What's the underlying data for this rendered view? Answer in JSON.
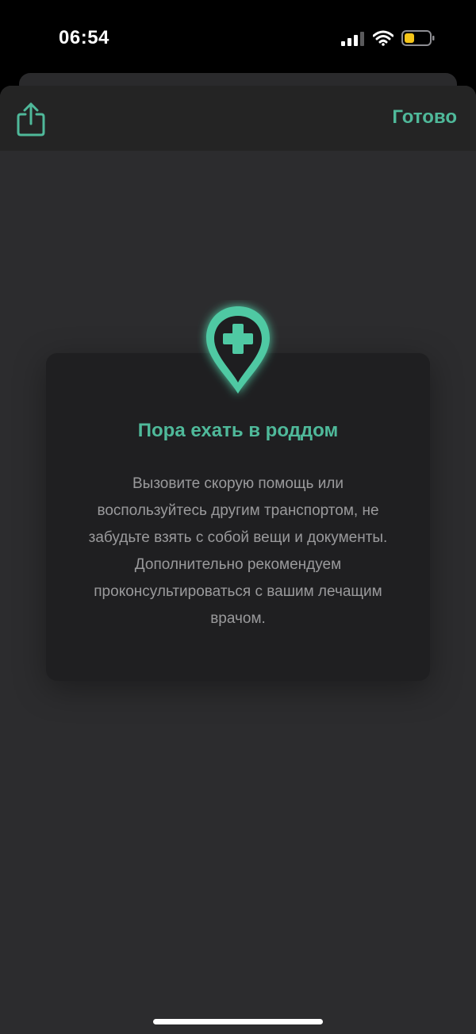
{
  "status_bar": {
    "time": "06:54"
  },
  "toolbar": {
    "done_label": "Готово"
  },
  "card": {
    "title": "Пора ехать в роддом",
    "text": "Вызовите скорую помощь или воспользуйтесь другим транспортом, не забудьте взять с собой вещи и документы. Дополнительно рекомендуем проконсультироваться с вашим лечащим врачом."
  },
  "colors": {
    "accent": "#4fb99a",
    "background": "#2c2c2e",
    "card": "#1f1f21",
    "battery_low": "#f5c518"
  },
  "icons": {
    "share": "share-icon",
    "pin": "medical-pin-icon",
    "signal": "cellular-signal-icon",
    "wifi": "wifi-icon",
    "battery": "battery-icon"
  }
}
